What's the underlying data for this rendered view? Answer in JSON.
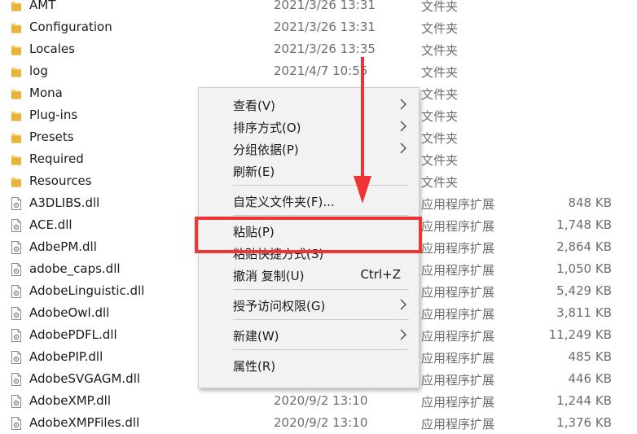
{
  "files": [
    {
      "name": "AMT",
      "date": "2021/3/26 13:31",
      "type": "文件夹",
      "size": "",
      "icon": "folder-icon"
    },
    {
      "name": "Configuration",
      "date": "2021/3/26 13:31",
      "type": "文件夹",
      "size": "",
      "icon": "folder-icon"
    },
    {
      "name": "Locales",
      "date": "2021/3/26 13:35",
      "type": "文件夹",
      "size": "",
      "icon": "folder-icon"
    },
    {
      "name": "log",
      "date": "2021/4/7 10:55",
      "type": "文件夹",
      "size": "",
      "icon": "folder-icon"
    },
    {
      "name": "Mona",
      "date": "",
      "type": "文件夹",
      "size": "",
      "icon": "folder-icon"
    },
    {
      "name": "Plug-ins",
      "date": "",
      "type": "文件夹",
      "size": "",
      "icon": "folder-icon"
    },
    {
      "name": "Presets",
      "date": "",
      "type": "文件夹",
      "size": "",
      "icon": "folder-icon"
    },
    {
      "name": "Required",
      "date": "",
      "type": "文件夹",
      "size": "",
      "icon": "folder-icon"
    },
    {
      "name": "Resources",
      "date": "",
      "type": "文件夹",
      "size": "",
      "icon": "folder-icon"
    },
    {
      "name": "A3DLIBS.dll",
      "date": "",
      "type": "应用程序扩展",
      "size": "848 KB",
      "icon": "dll-file-icon"
    },
    {
      "name": "ACE.dll",
      "date": "",
      "type": "应用程序扩展",
      "size": "1,748 KB",
      "icon": "dll-file-icon"
    },
    {
      "name": "AdbePM.dll",
      "date": "",
      "type": "应用程序扩展",
      "size": "2,864 KB",
      "icon": "dll-file-icon"
    },
    {
      "name": "adobe_caps.dll",
      "date": "",
      "type": "应用程序扩展",
      "size": "1,050 KB",
      "icon": "dll-file-icon"
    },
    {
      "name": "AdobeLinguistic.dll",
      "date": "",
      "type": "应用程序扩展",
      "size": "5,429 KB",
      "icon": "dll-file-icon"
    },
    {
      "name": "AdobeOwl.dll",
      "date": "",
      "type": "应用程序扩展",
      "size": "3,811 KB",
      "icon": "dll-file-icon"
    },
    {
      "name": "AdobePDFL.dll",
      "date": "",
      "type": "应用程序扩展",
      "size": "11,249 KB",
      "icon": "dll-file-icon"
    },
    {
      "name": "AdobePIP.dll",
      "date": "",
      "type": "应用程序扩展",
      "size": "485 KB",
      "icon": "dll-file-icon"
    },
    {
      "name": "AdobeSVGAGM.dll",
      "date": "",
      "type": "应用程序扩展",
      "size": "446 KB",
      "icon": "dll-file-icon"
    },
    {
      "name": "AdobeXMP.dll",
      "date": "2020/9/2 13:10",
      "type": "应用程序扩展",
      "size": "1,244 KB",
      "icon": "dll-file-icon"
    },
    {
      "name": "AdobeXMPFiles.dll",
      "date": "2020/9/2 13:10",
      "type": "应用程序扩展",
      "size": "1,376 KB",
      "icon": "dll-file-icon"
    }
  ],
  "context_menu": {
    "items": [
      {
        "label": "查看(V)",
        "submenu": true,
        "shortcut": ""
      },
      {
        "label": "排序方式(O)",
        "submenu": true,
        "shortcut": ""
      },
      {
        "label": "分组依据(P)",
        "submenu": true,
        "shortcut": ""
      },
      {
        "label": "刷新(E)",
        "submenu": false,
        "shortcut": ""
      },
      {
        "separator": true
      },
      {
        "label": "自定义文件夹(F)...",
        "submenu": false,
        "shortcut": ""
      },
      {
        "separator": true
      },
      {
        "label": "粘贴(P)",
        "submenu": false,
        "shortcut": ""
      },
      {
        "label": "粘贴快捷方式(S)",
        "submenu": false,
        "shortcut": ""
      },
      {
        "label": "撤消 复制(U)",
        "submenu": false,
        "shortcut": "Ctrl+Z"
      },
      {
        "separator": true
      },
      {
        "label": "授予访问权限(G)",
        "submenu": true,
        "shortcut": ""
      },
      {
        "separator": true
      },
      {
        "label": "新建(W)",
        "submenu": true,
        "shortcut": ""
      },
      {
        "separator": true
      },
      {
        "label": "属性(R)",
        "submenu": false,
        "shortcut": ""
      }
    ]
  },
  "annotation": {
    "highlight_target": "粘贴(P)",
    "color": "#ee3434"
  },
  "colors": {
    "folder": "#f4c95d",
    "menu_bg": "#f2f2f2",
    "secondary_text": "#6d6d6d"
  }
}
